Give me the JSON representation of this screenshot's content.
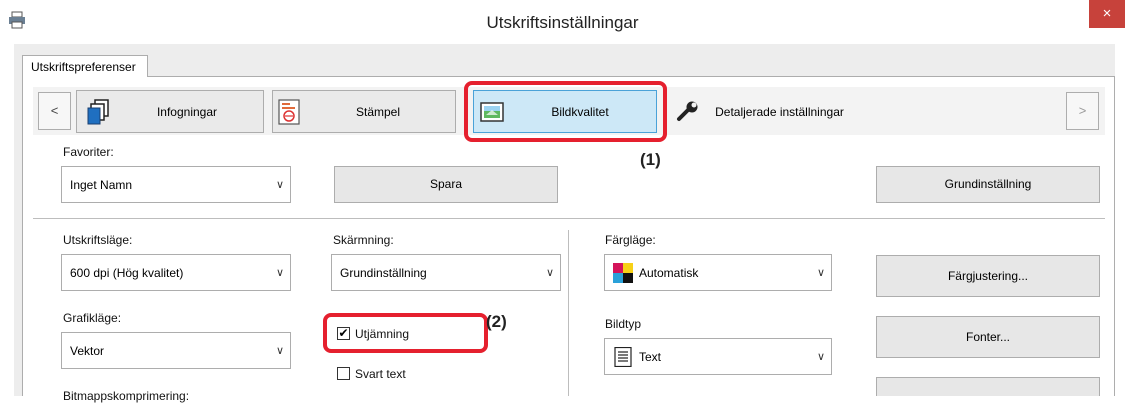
{
  "window": {
    "title": "Utskriftsinställningar",
    "close_glyph": "×",
    "icon": "printer-icon"
  },
  "tabs": [
    {
      "label": "Utskriftspreferenser",
      "selected": true
    }
  ],
  "nav": {
    "prev_glyph": "<",
    "next_glyph": ">",
    "items": [
      {
        "label": "Infogningar",
        "icon": "pages-icon",
        "selected": false
      },
      {
        "label": "Stämpel",
        "icon": "stamp-icon",
        "selected": false
      },
      {
        "label": "Bildkvalitet",
        "icon": "image-quality-icon",
        "selected": true
      },
      {
        "label": "Detaljerade inställningar",
        "icon": "wrench-icon",
        "selected": false
      }
    ]
  },
  "favorites": {
    "label": "Favoriter:",
    "value": "Inget Namn",
    "save_label": "Spara",
    "default_label": "Grundinställning"
  },
  "print_mode": {
    "label": "Utskriftsläge:",
    "value": "600 dpi (Hög kvalitet)"
  },
  "screening": {
    "label": "Skärmning:",
    "value": "Grundinställning"
  },
  "color_mode": {
    "label": "Färgläge:",
    "value": "Automatisk"
  },
  "color_adjust_label": "Färgjustering...",
  "graphics_mode": {
    "label": "Grafikläge:",
    "value": "Vektor"
  },
  "smoothing": {
    "label": "Utjämning",
    "checked": true
  },
  "black_text": {
    "label": "Svart text",
    "checked": false
  },
  "image_type": {
    "label": "Bildtyp",
    "value": "Text"
  },
  "fonts_label": "Fonter...",
  "bitmap_compression_label": "Bitmappskomprimering:",
  "callouts": {
    "one": "(1)",
    "two": "(2)"
  },
  "colors": {
    "accent_red": "#e5202e",
    "selected_tab": "#cde8f7",
    "close_red": "#c7423b"
  }
}
